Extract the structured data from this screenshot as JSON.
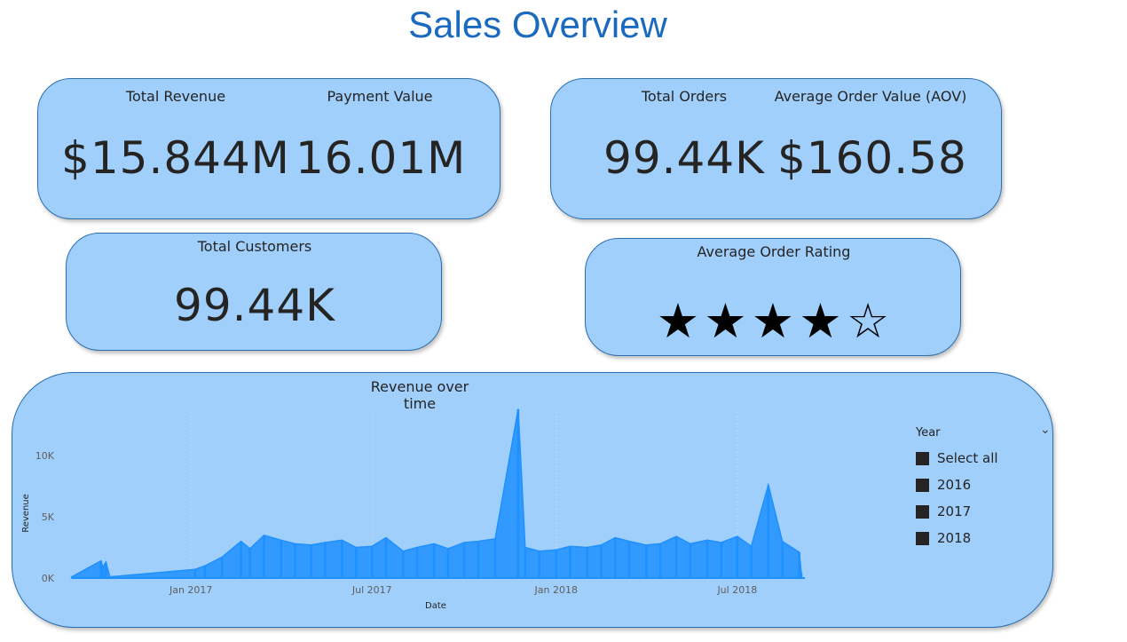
{
  "page": {
    "title": "Sales Overview"
  },
  "kpis": {
    "total_revenue": {
      "label": "Total Revenue",
      "value": "$15.844M"
    },
    "payment_value": {
      "label": "Payment Value",
      "value": "16.01M"
    },
    "total_orders": {
      "label": "Total Orders",
      "value": "99.44K"
    },
    "aov": {
      "label": "Average Order Value (AOV)",
      "value": "$160.58"
    },
    "total_customers": {
      "label": "Total Customers",
      "value": "99.44K"
    },
    "rating": {
      "label": "Average Order Rating",
      "stars_filled": 4,
      "stars_total": 5
    }
  },
  "slicer": {
    "title": "Year",
    "items": [
      {
        "label": "Select all"
      },
      {
        "label": "2016"
      },
      {
        "label": "2017"
      },
      {
        "label": "2018"
      }
    ]
  },
  "chart_data": {
    "type": "area",
    "title": "Revenue over time",
    "xlabel": "Date",
    "ylabel": "Revenue",
    "ylim": [
      0,
      14000
    ],
    "yticks": [
      {
        "value": 0,
        "label": "0K"
      },
      {
        "value": 5000,
        "label": "5K"
      },
      {
        "value": 10000,
        "label": "10K"
      }
    ],
    "xticks": [
      "Jan 2017",
      "Jul 2017",
      "Jan 2018",
      "Jul 2018"
    ],
    "gridlines_x": true,
    "color": "#1e90ff",
    "series": [
      {
        "x": [
          "2016-09-04",
          "2016-10-03",
          "2016-10-05",
          "2016-10-08",
          "2016-10-12",
          "2017-01-05",
          "2017-01-15",
          "2017-02-01",
          "2017-02-20",
          "2017-03-01",
          "2017-03-15",
          "2017-04-01",
          "2017-04-15",
          "2017-05-01",
          "2017-05-15",
          "2017-06-01",
          "2017-06-15",
          "2017-07-01",
          "2017-07-15",
          "2017-08-01",
          "2017-08-15",
          "2017-09-01",
          "2017-09-15",
          "2017-10-01",
          "2017-10-15",
          "2017-11-01",
          "2017-11-24",
          "2017-12-01",
          "2017-12-15",
          "2018-01-01",
          "2018-01-15",
          "2018-02-01",
          "2018-02-15",
          "2018-03-01",
          "2018-03-15",
          "2018-04-01",
          "2018-04-15",
          "2018-05-01",
          "2018-05-15",
          "2018-06-01",
          "2018-06-15",
          "2018-07-01",
          "2018-07-15",
          "2018-08-01",
          "2018-08-15",
          "2018-09-01",
          "2018-09-03"
        ],
        "values": [
          100,
          1400,
          900,
          1300,
          100,
          700,
          1000,
          1700,
          3000,
          2400,
          3500,
          3100,
          2800,
          2700,
          2900,
          3100,
          2500,
          2600,
          3300,
          2200,
          2500,
          2800,
          2400,
          2900,
          3000,
          3200,
          13800,
          2500,
          2200,
          2300,
          2600,
          2500,
          2700,
          3300,
          3000,
          2700,
          2800,
          3400,
          2800,
          3100,
          2900,
          3400,
          2600,
          7600,
          3000,
          2100,
          400
        ]
      }
    ]
  }
}
